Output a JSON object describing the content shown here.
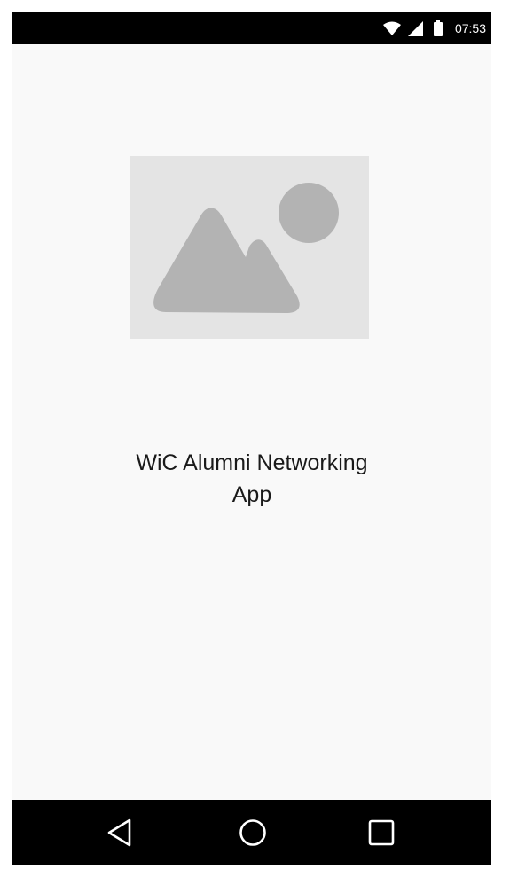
{
  "status_bar": {
    "time": "07:53",
    "icons": [
      "wifi-icon",
      "cellular-signal-icon",
      "battery-icon"
    ]
  },
  "main": {
    "image": {
      "icon": "image-placeholder-icon",
      "background": "#e4e4e4",
      "glyph_color": "#b3b3b3"
    },
    "title_lines": [
      "WiC Alumni Networking",
      "App"
    ]
  },
  "nav_bar": {
    "buttons": [
      "back-button",
      "home-button",
      "recents-button"
    ]
  },
  "colors": {
    "screen_background": "#f9f9f9",
    "system_bars": "#000000",
    "text": "#1a1a1a"
  }
}
